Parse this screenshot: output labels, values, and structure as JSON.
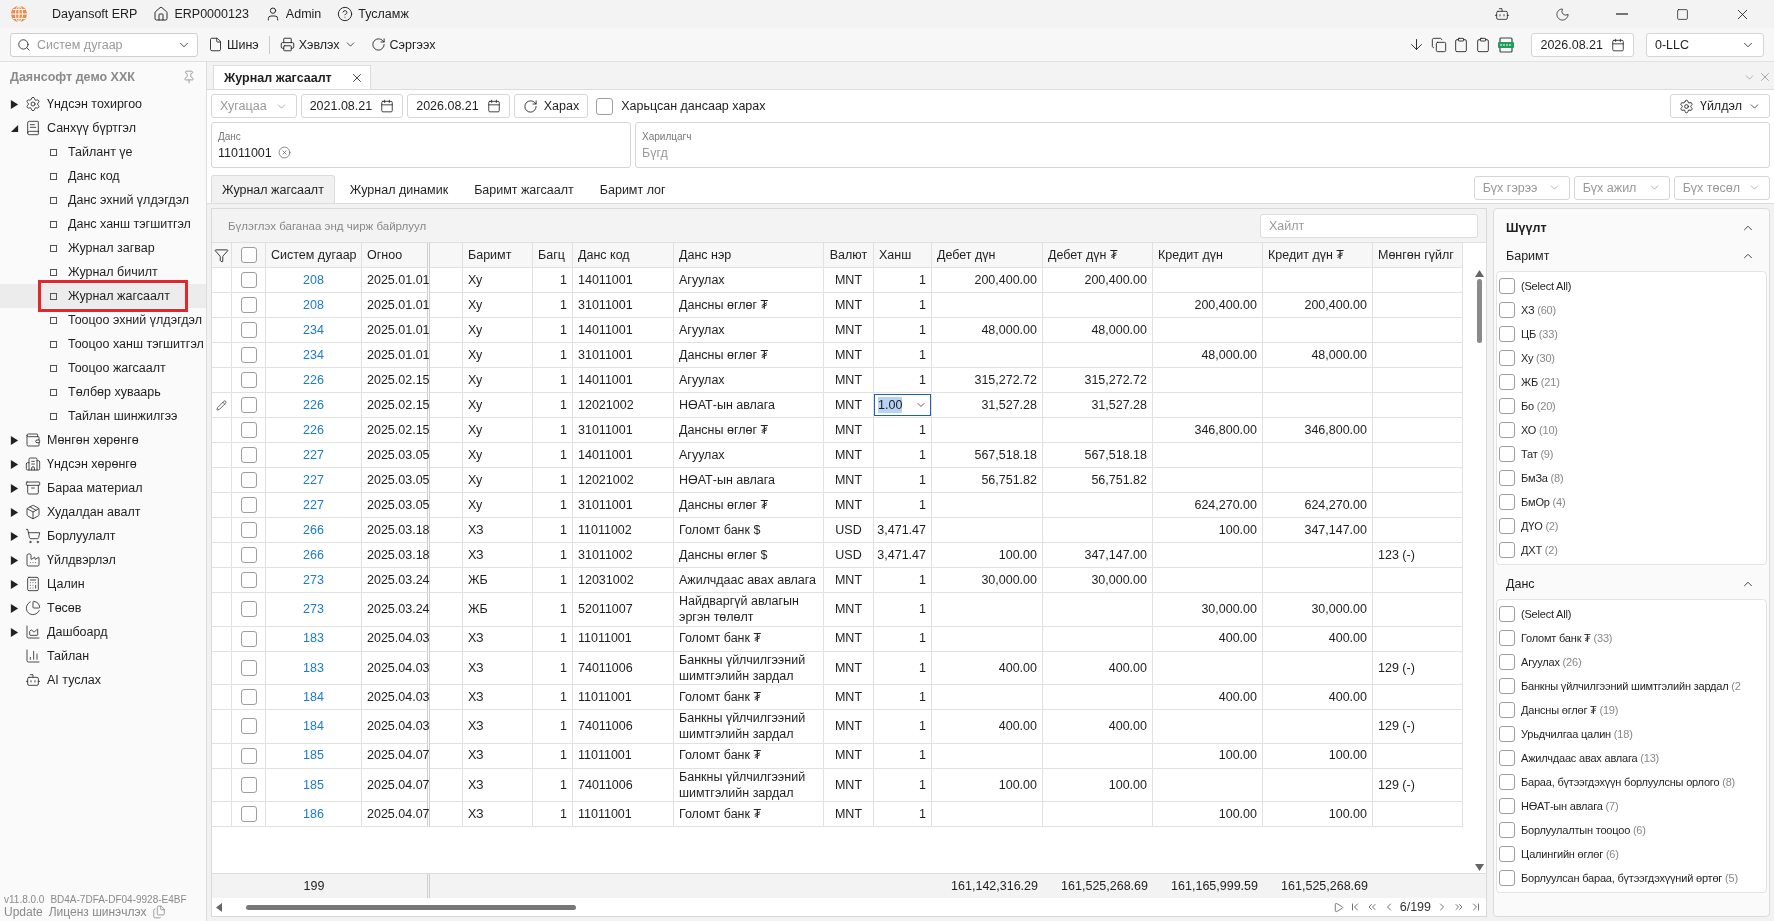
{
  "titlebar": {
    "app_name": "Dayansoft ERP",
    "links": [
      "ERP0000123",
      "Admin",
      "Тусламж"
    ]
  },
  "toolbar": {
    "search_placeholder": "Систем дугаар",
    "buttons": [
      "Шинэ",
      "Хэвлэх",
      "Сэргээх"
    ],
    "date": "2026.08.21",
    "company": "0-LLC"
  },
  "sidebar": {
    "title": "Даянсофт демо ХХК",
    "items": [
      {
        "label": "Үндсэн тохиргоо",
        "expanded": false,
        "selected": false
      },
      {
        "label": "Санхүү бүртгэл",
        "expanded": true,
        "selected": false,
        "children": [
          {
            "label": "Тайлант үе",
            "selected": false
          },
          {
            "label": "Данс код",
            "selected": false
          },
          {
            "label": "Данс эхний үлдэгдэл",
            "selected": false
          },
          {
            "label": "Данс ханш тэгшитгэл",
            "selected": false
          },
          {
            "label": "Журнал загвар",
            "selected": false
          },
          {
            "label": "Журнал бичилт",
            "selected": false
          },
          {
            "label": "Журнал жагсаалт",
            "selected": true
          },
          {
            "label": "Тооцоо эхний үлдэгдэл",
            "selected": false
          },
          {
            "label": "Тооцоо ханш тэгшитгэл",
            "selected": false
          },
          {
            "label": "Тооцоо жагсаалт",
            "selected": false
          },
          {
            "label": "Төлбөр хуваарь",
            "selected": false
          },
          {
            "label": "Тайлан шинжилгээ",
            "selected": false
          }
        ]
      },
      {
        "label": "Мөнгөн хөрөнгө",
        "expanded": false,
        "selected": false
      },
      {
        "label": "Үндсэн хөрөнгө",
        "expanded": false,
        "selected": false
      },
      {
        "label": "Бараа материал",
        "expanded": false,
        "selected": false
      },
      {
        "label": "Худалдан авалт",
        "expanded": false,
        "selected": false
      },
      {
        "label": "Борлуулалт",
        "expanded": false,
        "selected": false
      },
      {
        "label": "Үйлдвэрлэл",
        "expanded": false,
        "selected": false
      },
      {
        "label": "Цалин",
        "expanded": false,
        "selected": false
      },
      {
        "label": "Төсөв",
        "expanded": false,
        "selected": false
      },
      {
        "label": "Дашбоард",
        "expanded": false,
        "selected": false
      },
      {
        "label": "Тайлан",
        "selected": false
      },
      {
        "label": "AI туслах",
        "selected": false
      }
    ],
    "version": "v11.8.0.0",
    "license_key": "BD4A-7DFA-DF04-9928-E4BF",
    "update_link": "Update",
    "license_link": "Лиценз шинэчлэх"
  },
  "document_tab": {
    "title": "Журнал жагсаалт"
  },
  "filters": {
    "period_placeholder": "Хугацаа",
    "date_from": "2021.08.21",
    "date_to": "2026.08.21",
    "view_button": "Харах",
    "related_checkbox": {
      "label": "Харьцсан дансаар харах",
      "checked": false
    },
    "action_button": "Үйлдэл"
  },
  "account_field": {
    "label": "Данс",
    "chips": [
      "11011001"
    ]
  },
  "partner_field": {
    "label": "Харилцагч",
    "placeholder": "Бүгд"
  },
  "tabs": [
    {
      "label": "Журнал жагсаалт",
      "selected": true
    },
    {
      "label": "Журнал динамик",
      "selected": false
    },
    {
      "label": "Баримт жагсаалт",
      "selected": false
    },
    {
      "label": "Баримт лог",
      "selected": false
    }
  ],
  "dimension_selects": [
    {
      "placeholder": "Бүх гэрээ"
    },
    {
      "placeholder": "Бүх ажил"
    },
    {
      "placeholder": "Бүх төсөл"
    }
  ],
  "grid": {
    "group_hint": "Бүлэглэх баганаа энд чирж байрлуул",
    "search_placeholder": "Хайлт",
    "select_all_checked": false,
    "columns": [
      "Систем дугаар",
      "Огноо",
      "Баримт",
      "Багц",
      "Данс код",
      "Данс нэр",
      "Валют",
      "Ханш",
      "Дебет дүн",
      "Дебет дүн ₮",
      "Кредит дүн",
      "Кредит дүн ₮",
      "Мөнгөн гүйлг"
    ],
    "rows": [
      {
        "system_no": "208",
        "date": "2025.01.01",
        "document": "Ху",
        "batch": "1",
        "account_code": "14011001",
        "account_name": "Агуулах",
        "currency": "MNT",
        "rate": "1",
        "debit": "200,400.00",
        "debit_mnt": "200,400.00",
        "checked": false,
        "editing": false
      },
      {
        "system_no": "208",
        "date": "2025.01.01",
        "document": "Ху",
        "batch": "1",
        "account_code": "31011001",
        "account_name": "Дансны өглөг ₮",
        "currency": "MNT",
        "rate": "1",
        "credit": "200,400.00",
        "credit_mnt": "200,400.00",
        "checked": false,
        "editing": false
      },
      {
        "system_no": "234",
        "date": "2025.01.01",
        "document": "Ху",
        "batch": "1",
        "account_code": "14011001",
        "account_name": "Агуулах",
        "currency": "MNT",
        "rate": "1",
        "debit": "48,000.00",
        "debit_mnt": "48,000.00",
        "checked": false,
        "editing": false
      },
      {
        "system_no": "234",
        "date": "2025.01.01",
        "document": "Ху",
        "batch": "1",
        "account_code": "31011001",
        "account_name": "Дансны өглөг ₮",
        "currency": "MNT",
        "rate": "1",
        "credit": "48,000.00",
        "credit_mnt": "48,000.00",
        "checked": false,
        "editing": false
      },
      {
        "system_no": "226",
        "date": "2025.02.15",
        "document": "Ху",
        "batch": "1",
        "account_code": "14011001",
        "account_name": "Агуулах",
        "currency": "MNT",
        "rate": "1",
        "debit": "315,272.72",
        "debit_mnt": "315,272.72",
        "checked": false,
        "editing": false
      },
      {
        "system_no": "226",
        "date": "2025.02.15",
        "document": "Ху",
        "batch": "1",
        "account_code": "12021002",
        "account_name": "НӨАТ-ын авлага",
        "currency": "MNT",
        "rate": "1.00",
        "debit": "31,527.28",
        "debit_mnt": "31,527.28",
        "checked": false,
        "editing": true
      },
      {
        "system_no": "226",
        "date": "2025.02.15",
        "document": "Ху",
        "batch": "1",
        "account_code": "31011001",
        "account_name": "Дансны өглөг ₮",
        "currency": "MNT",
        "rate": "1",
        "credit": "346,800.00",
        "credit_mnt": "346,800.00",
        "checked": false,
        "editing": false
      },
      {
        "system_no": "227",
        "date": "2025.03.05",
        "document": "Ху",
        "batch": "1",
        "account_code": "14011001",
        "account_name": "Агуулах",
        "currency": "MNT",
        "rate": "1",
        "debit": "567,518.18",
        "debit_mnt": "567,518.18",
        "checked": false,
        "editing": false
      },
      {
        "system_no": "227",
        "date": "2025.03.05",
        "document": "Ху",
        "batch": "1",
        "account_code": "12021002",
        "account_name": "НӨАТ-ын авлага",
        "currency": "MNT",
        "rate": "1",
        "debit": "56,751.82",
        "debit_mnt": "56,751.82",
        "checked": false,
        "editing": false
      },
      {
        "system_no": "227",
        "date": "2025.03.05",
        "document": "Ху",
        "batch": "1",
        "account_code": "31011001",
        "account_name": "Дансны өглөг ₮",
        "currency": "MNT",
        "rate": "1",
        "credit": "624,270.00",
        "credit_mnt": "624,270.00",
        "checked": false,
        "editing": false
      },
      {
        "system_no": "266",
        "date": "2025.03.18",
        "document": "ХЗ",
        "batch": "1",
        "account_code": "11011002",
        "account_name": "Голомт банк $",
        "currency": "USD",
        "rate": "3,471.47",
        "credit": "100.00",
        "credit_mnt": "347,147.00",
        "checked": false,
        "editing": false
      },
      {
        "system_no": "266",
        "date": "2025.03.18",
        "document": "ХЗ",
        "batch": "1",
        "account_code": "31011002",
        "account_name": "Дансны өглөг $",
        "currency": "USD",
        "rate": "3,471.47",
        "debit": "100.00",
        "debit_mnt": "347,147.00",
        "cash_flow": "123 (-)",
        "checked": false,
        "editing": false
      },
      {
        "system_no": "273",
        "date": "2025.03.24",
        "document": "ЖБ",
        "batch": "1",
        "account_code": "12031002",
        "account_name": "Ажилчдаас авах авлага",
        "currency": "MNT",
        "rate": "1",
        "debit": "30,000.00",
        "debit_mnt": "30,000.00",
        "checked": false,
        "editing": false
      },
      {
        "system_no": "273",
        "date": "2025.03.24",
        "document": "ЖБ",
        "batch": "1",
        "account_code": "52011007",
        "account_name": "Найдваргүй авлагын эргэн төлөлт",
        "currency": "MNT",
        "rate": "1",
        "credit": "30,000.00",
        "credit_mnt": "30,000.00",
        "checked": false,
        "editing": false
      },
      {
        "system_no": "183",
        "date": "2025.04.03",
        "document": "ХЗ",
        "batch": "1",
        "account_code": "11011001",
        "account_name": "Голомт банк ₮",
        "currency": "MNT",
        "rate": "1",
        "credit": "400.00",
        "credit_mnt": "400.00",
        "checked": false,
        "editing": false
      },
      {
        "system_no": "183",
        "date": "2025.04.03",
        "document": "ХЗ",
        "batch": "1",
        "account_code": "74011006",
        "account_name": "Банкны үйлчилгээний шимтгэлийн зардал",
        "currency": "MNT",
        "rate": "1",
        "debit": "400.00",
        "debit_mnt": "400.00",
        "cash_flow": "129 (-)",
        "checked": false,
        "editing": false
      },
      {
        "system_no": "184",
        "date": "2025.04.03",
        "document": "ХЗ",
        "batch": "1",
        "account_code": "11011001",
        "account_name": "Голомт банк ₮",
        "currency": "MNT",
        "rate": "1",
        "credit": "400.00",
        "credit_mnt": "400.00",
        "checked": false,
        "editing": false
      },
      {
        "system_no": "184",
        "date": "2025.04.03",
        "document": "ХЗ",
        "batch": "1",
        "account_code": "74011006",
        "account_name": "Банкны үйлчилгээний шимтгэлийн зардал",
        "currency": "MNT",
        "rate": "1",
        "debit": "400.00",
        "debit_mnt": "400.00",
        "cash_flow": "129 (-)",
        "checked": false,
        "editing": false
      },
      {
        "system_no": "185",
        "date": "2025.04.07",
        "document": "ХЗ",
        "batch": "1",
        "account_code": "11011001",
        "account_name": "Голомт банк ₮",
        "currency": "MNT",
        "rate": "1",
        "credit": "100.00",
        "credit_mnt": "100.00",
        "checked": false,
        "editing": false
      },
      {
        "system_no": "185",
        "date": "2025.04.07",
        "document": "ХЗ",
        "batch": "1",
        "account_code": "74011006",
        "account_name": "Банкны үйлчилгээний шимтгэлийн зардал",
        "currency": "MNT",
        "rate": "1",
        "debit": "100.00",
        "debit_mnt": "100.00",
        "cash_flow": "129 (-)",
        "checked": false,
        "editing": false
      },
      {
        "system_no": "186",
        "date": "2025.04.07",
        "document": "ХЗ",
        "batch": "1",
        "account_code": "11011001",
        "account_name": "Голомт банк ₮",
        "currency": "MNT",
        "rate": "1",
        "credit": "100.00",
        "credit_mnt": "100.00",
        "checked": false,
        "editing": false
      }
    ],
    "footer": {
      "count": "199",
      "totals": [
        "161,142,316.29",
        "161,525,268.69",
        "161,165,999.59",
        "161,525,268.69"
      ]
    },
    "pager": "6/199"
  },
  "filter_panel": {
    "title": "Шүүлт",
    "expanded": true,
    "groups": [
      {
        "title": "Баримт",
        "expanded": true,
        "items": [
          {
            "label": "(Select All)",
            "checked": false
          },
          {
            "label": "ХЗ",
            "count": "(60)",
            "checked": false
          },
          {
            "label": "ЦБ",
            "count": "(33)",
            "checked": false
          },
          {
            "label": "Ху",
            "count": "(30)",
            "checked": false
          },
          {
            "label": "ЖБ",
            "count": "(21)",
            "checked": false
          },
          {
            "label": "Бо",
            "count": "(20)",
            "checked": false
          },
          {
            "label": "ХО",
            "count": "(10)",
            "checked": false
          },
          {
            "label": "Тат",
            "count": "(9)",
            "checked": false
          },
          {
            "label": "БмЗа",
            "count": "(8)",
            "checked": false
          },
          {
            "label": "БмОр",
            "count": "(4)",
            "checked": false
          },
          {
            "label": "ДҮО",
            "count": "(2)",
            "checked": false
          },
          {
            "label": "ДХТ",
            "count": "(2)",
            "checked": false
          }
        ]
      },
      {
        "title": "Данс",
        "expanded": true,
        "items": [
          {
            "label": "(Select All)",
            "checked": false
          },
          {
            "label": "Голомт банк ₮",
            "count": "(33)",
            "checked": false
          },
          {
            "label": "Агуулах",
            "count": "(26)",
            "checked": false
          },
          {
            "label": "Банкны үйлчилгээний шимтгэлийн зардал",
            "count": "(2",
            "checked": false
          },
          {
            "label": "Дансны өглөг ₮",
            "count": "(19)",
            "checked": false
          },
          {
            "label": "Урьдчилгаа цалин",
            "count": "(18)",
            "checked": false
          },
          {
            "label": "Ажилчдаас авах авлага",
            "count": "(13)",
            "checked": false
          },
          {
            "label": "Бараа, бүтээгдэхүүн борлуулсны орлого",
            "count": "(8)",
            "checked": false
          },
          {
            "label": "НӨАТ-ын авлага",
            "count": "(7)",
            "checked": false
          },
          {
            "label": "Борлуулалтын тооцоо",
            "count": "(6)",
            "checked": false
          },
          {
            "label": "Цалингийн өглөг",
            "count": "(6)",
            "checked": false
          },
          {
            "label": "Борлуулсан бараа, бүтээгдэхүүний өртөг",
            "count": "(5)",
            "checked": false
          }
        ]
      }
    ]
  }
}
